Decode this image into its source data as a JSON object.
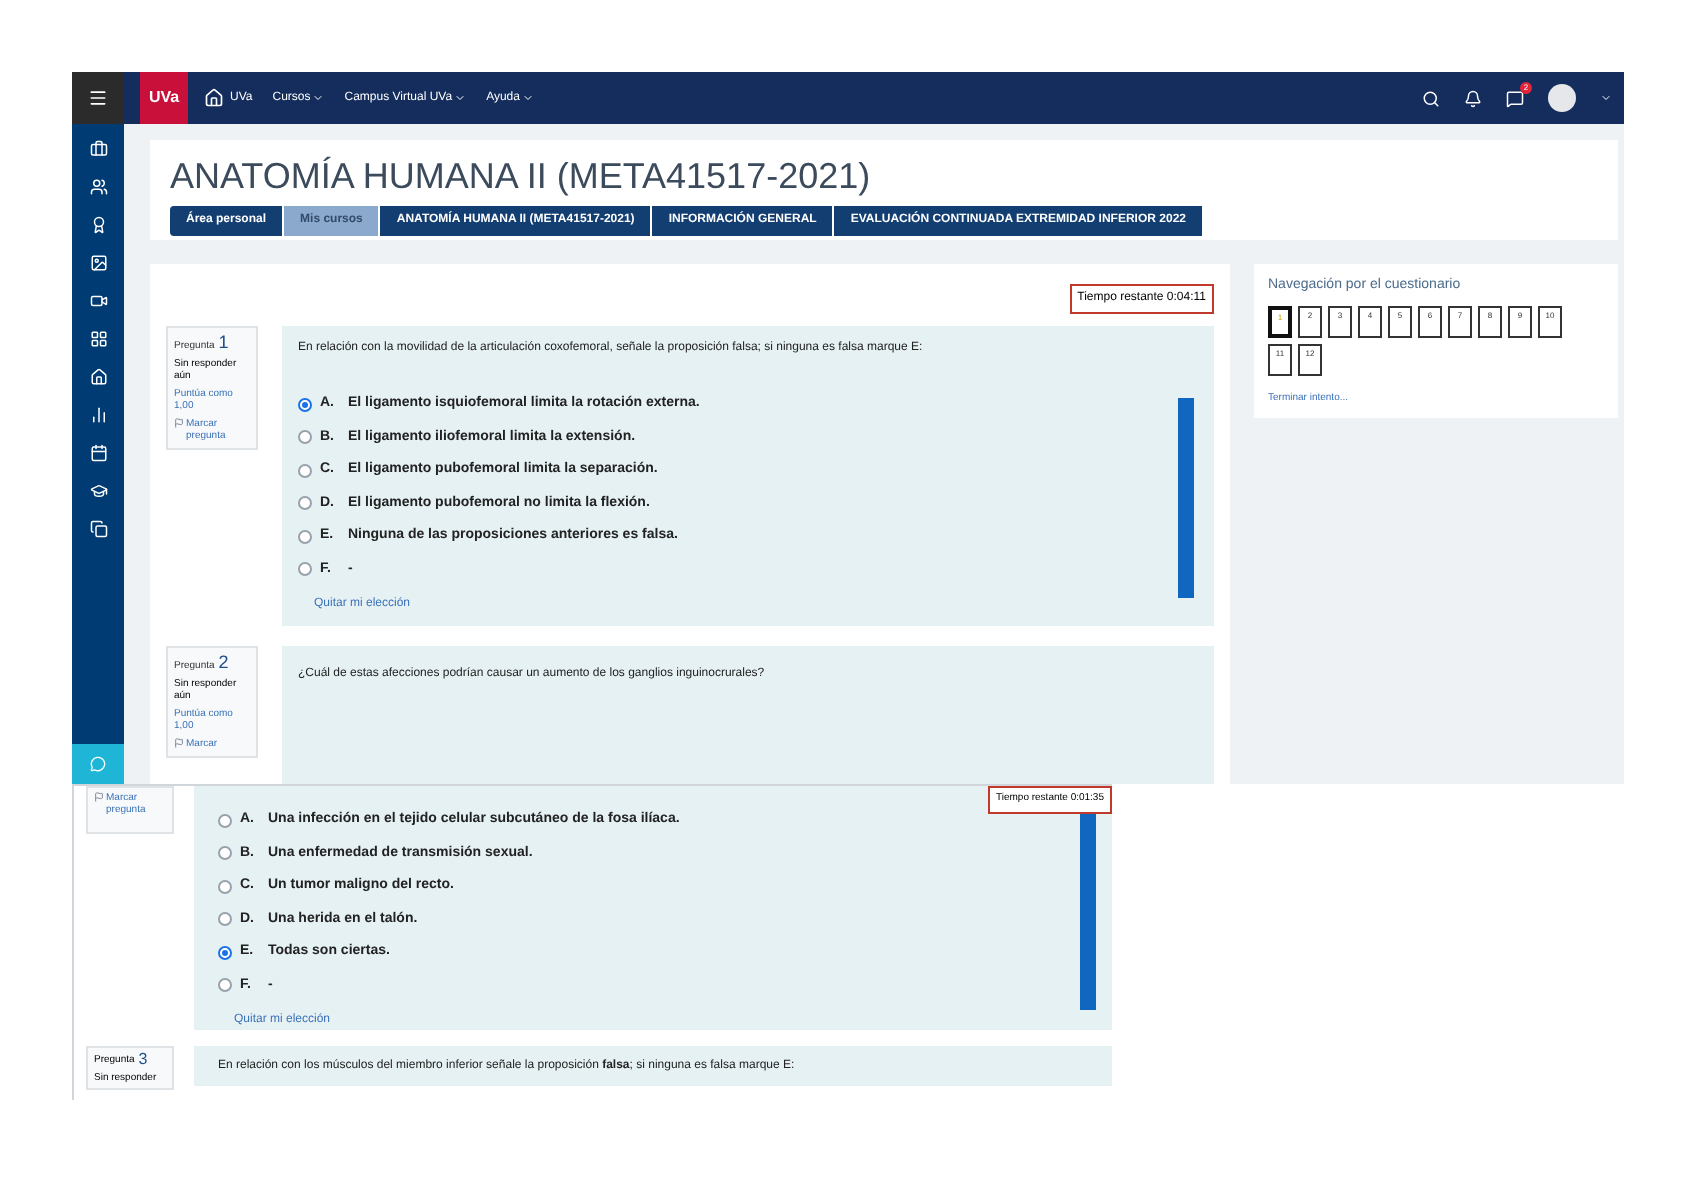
{
  "navbar": {
    "logo": "UVa",
    "home": "UVa",
    "menus": [
      "Cursos",
      "Campus Virtual UVa",
      "Ayuda"
    ],
    "notification_badge": "2"
  },
  "header": {
    "title": "ANATOMÍA HUMANA II (META41517-2021)",
    "breadcrumb": [
      {
        "label": "Área personal",
        "highlighted": false
      },
      {
        "label": "Mis cursos",
        "highlighted": true
      },
      {
        "label": "ANATOMÍA HUMANA II (META41517-2021)",
        "highlighted": false
      },
      {
        "label": "INFORMACIÓN GENERAL",
        "highlighted": false
      },
      {
        "label": "EVALUACIÓN CONTINUADA EXTREMIDAD INFERIOR 2022",
        "highlighted": false
      }
    ]
  },
  "quiz": {
    "timer": "Tiempo restante 0:04:11",
    "questions": [
      {
        "label": "Pregunta",
        "number": "1",
        "status": "Sin responder aún",
        "points": "Puntúa como 1,00",
        "flag": "Marcar pregunta",
        "text": "En relación con la movilidad de la articulación coxofemoral, señale la proposición falsa; si ninguna es falsa marque E:",
        "options": [
          {
            "letter": "A.",
            "text": "El ligamento isquiofemoral limita la rotación externa.",
            "selected": true
          },
          {
            "letter": "B.",
            "text": "El ligamento iliofemoral limita la extensión.",
            "selected": false
          },
          {
            "letter": "C.",
            "text": "El ligamento pubofemoral limita la separación.",
            "selected": false
          },
          {
            "letter": "D.",
            "text": "El ligamento pubofemoral no limita la flexión.",
            "selected": false
          },
          {
            "letter": "E.",
            "text": "Ninguna de las proposiciones anteriores es falsa.",
            "selected": false
          },
          {
            "letter": "F.",
            "text": "-",
            "selected": false
          }
        ],
        "clear": "Quitar mi elección"
      },
      {
        "label": "Pregunta",
        "number": "2",
        "status": "Sin responder aún",
        "points": "Puntúa como 1,00",
        "flag": "Marcar",
        "text": "¿Cuál de estas afecciones podrían causar un aumento de los ganglios inguinocrurales?"
      }
    ]
  },
  "navigation": {
    "title": "Navegación por el cuestionario",
    "buttons": [
      {
        "label": "1",
        "selected": true
      },
      {
        "label": "2",
        "selected": false
      },
      {
        "label": "3",
        "selected": false
      },
      {
        "label": "4",
        "selected": false
      },
      {
        "label": "5",
        "selected": false
      },
      {
        "label": "6",
        "selected": false
      },
      {
        "label": "7",
        "selected": false
      },
      {
        "label": "8",
        "selected": false
      },
      {
        "label": "9",
        "selected": false
      },
      {
        "label": "10",
        "selected": false
      },
      {
        "label": "11",
        "selected": false
      },
      {
        "label": "12",
        "selected": false
      }
    ],
    "finish": "Terminar intento..."
  },
  "second_capture": {
    "flag": "Marcar pregunta",
    "timer": "Tiempo restante 0:01:35",
    "options": [
      {
        "letter": "A.",
        "text": "Una infección en el tejido celular subcutáneo de la fosa ilíaca.",
        "selected": false
      },
      {
        "letter": "B.",
        "text": "Una enfermedad de transmisión sexual.",
        "selected": false
      },
      {
        "letter": "C.",
        "text": "Un tumor maligno del recto.",
        "selected": false
      },
      {
        "letter": "D.",
        "text": "Una herida en el talón.",
        "selected": false
      },
      {
        "letter": "E.",
        "text": "Todas son ciertas.",
        "selected": true
      },
      {
        "letter": "F.",
        "text": "-",
        "selected": false
      }
    ],
    "clear": "Quitar mi elección",
    "next_question": {
      "label": "Pregunta",
      "number": "3",
      "status": "Sin responder",
      "text": "En relación con los músculos del miembro inferior señale la proposición **falsa**; si ninguna es falsa marque E:"
    }
  }
}
